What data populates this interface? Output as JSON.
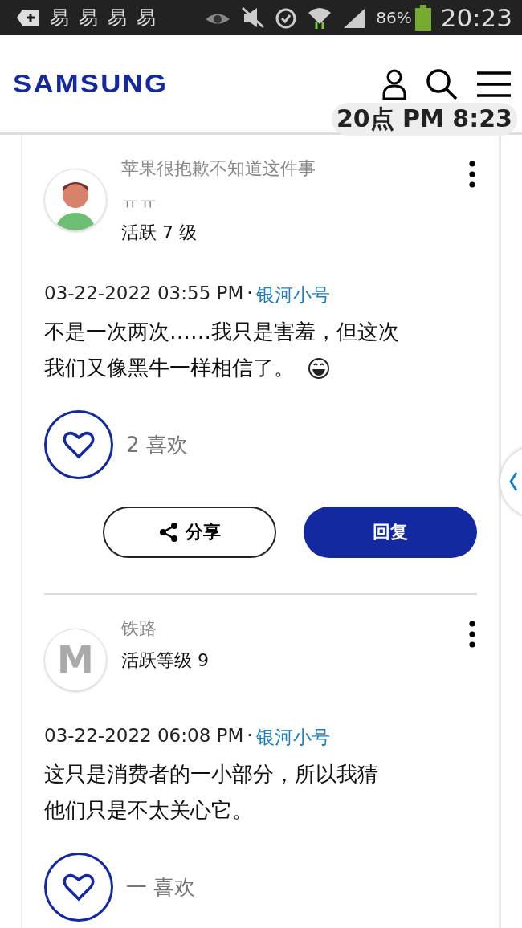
{
  "status_bar": {
    "notification_glyphs": [
      "易",
      "易",
      "易",
      "易"
    ],
    "battery": "86%",
    "time": "20:23"
  },
  "header": {
    "logo": "SAMSUNG"
  },
  "clock_overlay": "20点 PM 8:23",
  "posts": [
    {
      "avatar": {
        "kind": "cartoon"
      },
      "author": "苹果很抱歉不知道这件事",
      "author_suffix": "ㅠㅠ",
      "rank": "活跃 7 级",
      "date": "03-22-2022 03:55 PM",
      "separator": "·",
      "device": "银河小号",
      "body": [
        "不是一次两次……我只是害羞，但这次",
        "我们又像黑牛一样相信了。"
      ],
      "emoji": true,
      "likes": "2 喜欢",
      "actions": {
        "share": "分享",
        "reply": "回复"
      }
    },
    {
      "avatar": {
        "kind": "letter",
        "letter": "M"
      },
      "author": "铁路",
      "rank": "活跃等级 9",
      "date": "03-22-2022 06:08 PM",
      "separator": "·",
      "device": "银河小号",
      "body": [
        "这只是消费者的一小部分，所以我猜",
        "他们只是不太关心它。"
      ],
      "emoji": false,
      "likes": "一 喜欢"
    }
  ]
}
